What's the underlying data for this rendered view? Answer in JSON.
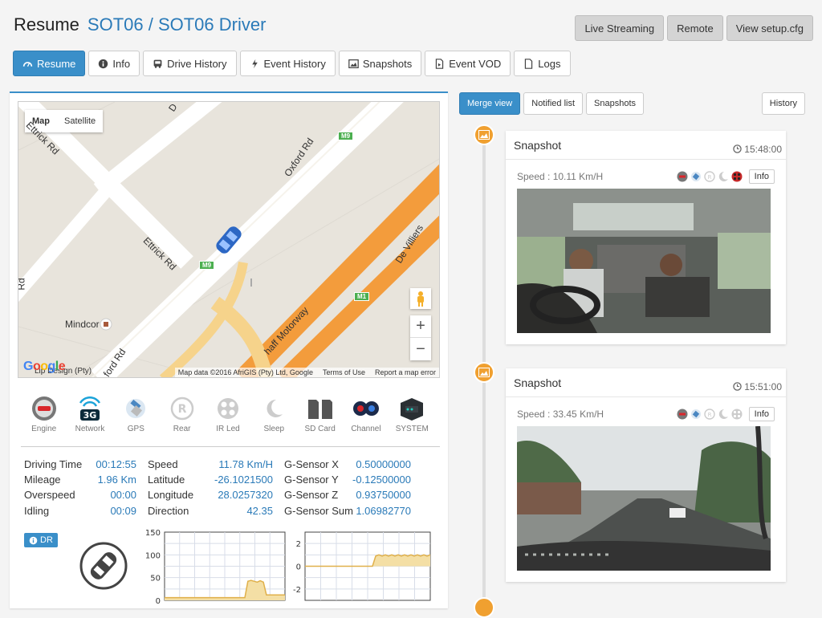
{
  "header": {
    "title": "Resume",
    "subtitle": "SOT06 / SOT06 Driver",
    "actions": [
      "Live Streaming",
      "Remote",
      "View setup.cfg"
    ]
  },
  "tabs": [
    {
      "label": "Resume",
      "icon": "dashboard-icon",
      "active": true
    },
    {
      "label": "Info",
      "icon": "info-icon",
      "active": false
    },
    {
      "label": "Drive History",
      "icon": "bus-icon",
      "active": false
    },
    {
      "label": "Event History",
      "icon": "bolt-icon",
      "active": false
    },
    {
      "label": "Snapshots",
      "icon": "image-icon",
      "active": false
    },
    {
      "label": "Event VOD",
      "icon": "file-video-icon",
      "active": false
    },
    {
      "label": "Logs",
      "icon": "file-icon",
      "active": false
    }
  ],
  "map": {
    "type_map": "Map",
    "type_satellite": "Satellite",
    "labels": {
      "oxford_rd": "Oxford Rd",
      "ettrick_rd_1": "Ettrick Rd",
      "ettrick_rd_2": "Ettrick Rd",
      "de_villiers": "De Villiers",
      "motorway": "haff Motorway",
      "mindcor": "Mindcor",
      "ford_rd": "ford Rd",
      "lip": "Lip Design (Pty)",
      "rd_left": "Rd",
      "d_top": "D"
    },
    "shields": [
      "M9",
      "M9",
      "M1"
    ],
    "footer": [
      "Map data ©2016 AfriGIS (Pty) Ltd, Google",
      "Terms of Use",
      "Report a map error"
    ],
    "logo": "Google",
    "zoom_in": "+",
    "zoom_out": "−"
  },
  "status_icons": [
    {
      "label": "Engine",
      "icon": "engine-icon"
    },
    {
      "label": "Network",
      "icon": "network-3g-icon",
      "badge": "3G"
    },
    {
      "label": "GPS",
      "icon": "gps-satellite-icon"
    },
    {
      "label": "Rear",
      "icon": "rear-icon"
    },
    {
      "label": "IR Led",
      "icon": "ir-led-icon"
    },
    {
      "label": "Sleep",
      "icon": "sleep-moon-icon"
    },
    {
      "label": "SD Card",
      "icon": "sd-card-icon"
    },
    {
      "label": "Channel",
      "icon": "channel-cameras-icon"
    },
    {
      "label": "SYSTEM",
      "icon": "system-box-icon"
    }
  ],
  "stats": {
    "col1": [
      {
        "label": "Driving Time",
        "value": "00:12:55"
      },
      {
        "label": "Mileage",
        "value": "1.96 Km"
      },
      {
        "label": "Overspeed",
        "value": "00:00"
      },
      {
        "label": "Idling",
        "value": "00:09"
      }
    ],
    "col2": [
      {
        "label": "Speed",
        "value": "11.78 Km/H"
      },
      {
        "label": "Latitude",
        "value": "-26.1021500"
      },
      {
        "label": "Longitude",
        "value": "28.0257320"
      },
      {
        "label": "Direction",
        "value": "42.35"
      }
    ],
    "col3": [
      {
        "label": "G-Sensor X",
        "value": "0.50000000"
      },
      {
        "label": "G-Sensor Y",
        "value": "-0.12500000"
      },
      {
        "label": "G-Sensor Z",
        "value": "0.93750000"
      },
      {
        "label": "G-Sensor Sum",
        "value": "1.06982770"
      }
    ]
  },
  "dr_label": "DR",
  "speed_chart": {
    "ticks": [
      "150",
      "100",
      "50",
      "0"
    ],
    "ylim": [
      0,
      150
    ],
    "values": [
      6,
      6,
      6,
      6,
      6,
      6,
      6,
      6,
      6,
      6,
      6,
      6,
      6,
      6,
      6,
      6,
      6,
      6,
      6,
      6,
      6,
      6,
      6,
      6,
      6,
      6,
      6,
      42,
      44,
      42,
      40,
      43,
      40,
      12,
      12,
      12,
      12,
      12,
      12,
      12
    ]
  },
  "gsensor_chart": {
    "ticks": [
      "2",
      "0",
      "-2"
    ],
    "ylim": [
      -3,
      3
    ],
    "values": [
      0,
      0,
      0,
      0,
      0,
      0,
      0,
      0,
      0,
      0,
      0,
      0,
      0,
      0,
      0,
      0,
      0,
      0,
      0,
      0,
      0,
      0,
      0.9,
      1.0,
      0.9,
      1.0,
      0.9,
      1.0,
      0.9,
      1.0,
      0.9,
      1.0,
      0.9,
      1.0,
      0.9,
      1.0,
      0.9,
      1.0,
      0.9,
      1.0
    ]
  },
  "right_tabs": [
    {
      "label": "Merge view",
      "active": true
    },
    {
      "label": "Notified list",
      "active": false
    },
    {
      "label": "Snapshots",
      "active": false
    }
  ],
  "history_label": "History",
  "snapshots": [
    {
      "title": "Snapshot",
      "time": "15:48:00",
      "speed": "Speed : 10.11 Km/H",
      "info": "Info"
    },
    {
      "title": "Snapshot",
      "time": "15:51:00",
      "speed": "Speed : 33.45 Km/H",
      "info": "Info"
    }
  ],
  "colors": {
    "accent": "#3a8fc9",
    "link": "#2a7ab8",
    "road_orange": "#f39c3c",
    "timeline_dot": "#f0a030",
    "chart_fill": "#f4dfa5"
  }
}
